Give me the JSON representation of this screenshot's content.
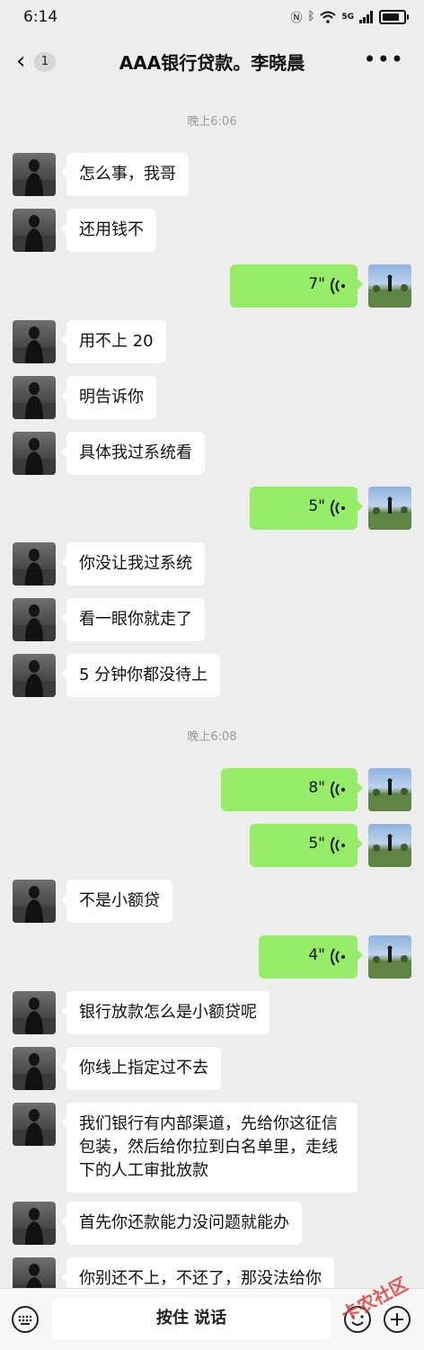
{
  "status": {
    "time": "6:14",
    "network": "5G"
  },
  "header": {
    "back_badge": "1",
    "title": "AAA银行贷款。李晓晨"
  },
  "time_separators": [
    "晚上6:06",
    "晚上6:08"
  ],
  "messages": [
    {
      "side": "in",
      "type": "text",
      "text": "怎么事，我哥"
    },
    {
      "side": "in",
      "type": "text",
      "text": "还用钱不"
    },
    {
      "side": "out",
      "type": "voice",
      "duration": "7\""
    },
    {
      "side": "in",
      "type": "text",
      "text": "用不上 20"
    },
    {
      "side": "in",
      "type": "text",
      "text": "明告诉你"
    },
    {
      "side": "in",
      "type": "text",
      "text": "具体我过系统看"
    },
    {
      "side": "out",
      "type": "voice",
      "duration": "5\""
    },
    {
      "side": "in",
      "type": "text",
      "text": "你没让我过系统"
    },
    {
      "side": "in",
      "type": "text",
      "text": "看一眼你就走了"
    },
    {
      "side": "in",
      "type": "text",
      "text": "5 分钟你都没待上"
    },
    {
      "side": "out",
      "type": "voice",
      "duration": "8\""
    },
    {
      "side": "out",
      "type": "voice",
      "duration": "5\""
    },
    {
      "side": "in",
      "type": "text",
      "text": "不是小额贷"
    },
    {
      "side": "out",
      "type": "voice",
      "duration": "4\""
    },
    {
      "side": "in",
      "type": "text",
      "text": "银行放款怎么是小额贷呢"
    },
    {
      "side": "in",
      "type": "text",
      "text": "你线上指定过不去"
    },
    {
      "side": "in",
      "type": "text",
      "text": "我们银行有内部渠道，先给你这征信包装，然后给你拉到白名单里，走线下的人工审批放款"
    },
    {
      "side": "in",
      "type": "text",
      "text": "首先你还款能力没问题就能办"
    },
    {
      "side": "in",
      "type": "text",
      "text": "你别还不上，不还了，那没法给你"
    }
  ],
  "input_bar": {
    "hold_to_talk": "按住 说话"
  },
  "watermark": {
    "text": "卡农社区"
  },
  "colors": {
    "background": "#ededed",
    "bubble_out": "#95ec69",
    "bubble_in": "#ffffff"
  }
}
